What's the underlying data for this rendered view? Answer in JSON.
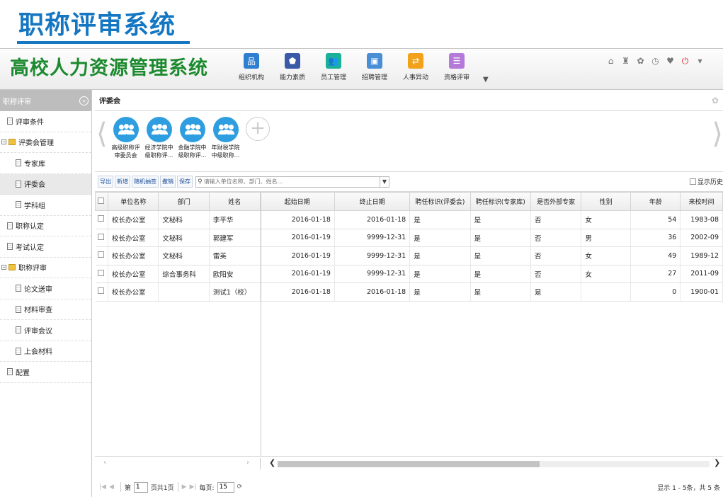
{
  "slide_title": "职称评审系统",
  "app": {
    "brand": "高校人力资源管理系统",
    "modules": [
      {
        "label": "组织机构",
        "icon": "org-chart-icon",
        "color": "#2f7fd0"
      },
      {
        "label": "能力素质",
        "icon": "pentagon-icon",
        "color": "#3a5aa8"
      },
      {
        "label": "员工管理",
        "icon": "employees-icon",
        "color": "#1bb09a"
      },
      {
        "label": "招聘管理",
        "icon": "id-card-icon",
        "color": "#4a8ed6"
      },
      {
        "label": "人事异动",
        "icon": "transfer-icon",
        "color": "#f2a21a"
      },
      {
        "label": "资格评审",
        "icon": "list-icon",
        "color": "#b57ad9"
      }
    ],
    "more_icon": "chevron-down-icon",
    "tools": [
      "home-icon",
      "shirt-icon",
      "gear-icon",
      "clock-icon",
      "heart-icon",
      "power-icon",
      "caret-down-icon"
    ]
  },
  "sidebar": {
    "title": "职称评审",
    "items": [
      {
        "label": "评审条件",
        "level": 1,
        "type": "doc"
      },
      {
        "label": "评委会管理",
        "level": 0,
        "type": "folder"
      },
      {
        "label": "专家库",
        "level": 2,
        "type": "doc"
      },
      {
        "label": "评委会",
        "level": 2,
        "type": "doc",
        "active": true
      },
      {
        "label": "学科组",
        "level": 2,
        "type": "doc"
      },
      {
        "label": "职称认定",
        "level": 1,
        "type": "doc"
      },
      {
        "label": "考试认定",
        "level": 1,
        "type": "doc"
      },
      {
        "label": "职称评审",
        "level": 0,
        "type": "folder"
      },
      {
        "label": "论文送审",
        "level": 2,
        "type": "doc"
      },
      {
        "label": "材料审查",
        "level": 2,
        "type": "doc"
      },
      {
        "label": "评审会议",
        "level": 2,
        "type": "doc"
      },
      {
        "label": "上会材料",
        "level": 2,
        "type": "doc"
      },
      {
        "label": "配置",
        "level": 1,
        "type": "doc"
      }
    ]
  },
  "main": {
    "panel_title": "评委会",
    "committees": [
      {
        "line1": "高级职称评",
        "line2": "审委员会"
      },
      {
        "line1": "经济学院中",
        "line2": "级职称评..."
      },
      {
        "line1": "金融学院中",
        "line2": "级职称评..."
      },
      {
        "line1": "年财税学院",
        "line2": "中级职称..."
      }
    ],
    "toolbar": {
      "buttons": [
        "导出",
        "新增",
        "随机抽签",
        "撤销",
        "保存"
      ],
      "search_placeholder": "请输入单位名称、部门、姓名...",
      "show_history": "显示历史"
    },
    "table": {
      "columns": [
        "单位名称",
        "部门",
        "姓名",
        "起始日期",
        "终止日期",
        "聘任标识(评委会)",
        "聘任标识(专家库)",
        "是否外部专家",
        "性别",
        "年龄",
        "来校时间"
      ],
      "rows": [
        [
          "校长办公室",
          "文秘科",
          "李平华",
          "2016-01-18",
          "2016-01-18",
          "是",
          "是",
          "否",
          "女",
          "54",
          "1983-08"
        ],
        [
          "校长办公室",
          "文秘科",
          "郭建军",
          "2016-01-19",
          "9999-12-31",
          "是",
          "是",
          "否",
          "男",
          "36",
          "2002-09"
        ],
        [
          "校长办公室",
          "文秘科",
          "雷英",
          "2016-01-19",
          "9999-12-31",
          "是",
          "是",
          "否",
          "女",
          "49",
          "1989-12"
        ],
        [
          "校长办公室",
          "综合事务科",
          "欧阳安",
          "2016-01-19",
          "9999-12-31",
          "是",
          "是",
          "否",
          "女",
          "27",
          "2011-09"
        ],
        [
          "校长办公室",
          "",
          "测试1（校）",
          "2016-01-18",
          "2016-01-18",
          "是",
          "是",
          "是",
          "",
          "0",
          "1900-01"
        ]
      ]
    },
    "pager": {
      "page_label": "第",
      "page_value": "1",
      "total_pages": "页共1页",
      "per_page_label": "每页:",
      "per_page_value": "15",
      "info": "显示 1 - 5条，共 5 条"
    }
  }
}
